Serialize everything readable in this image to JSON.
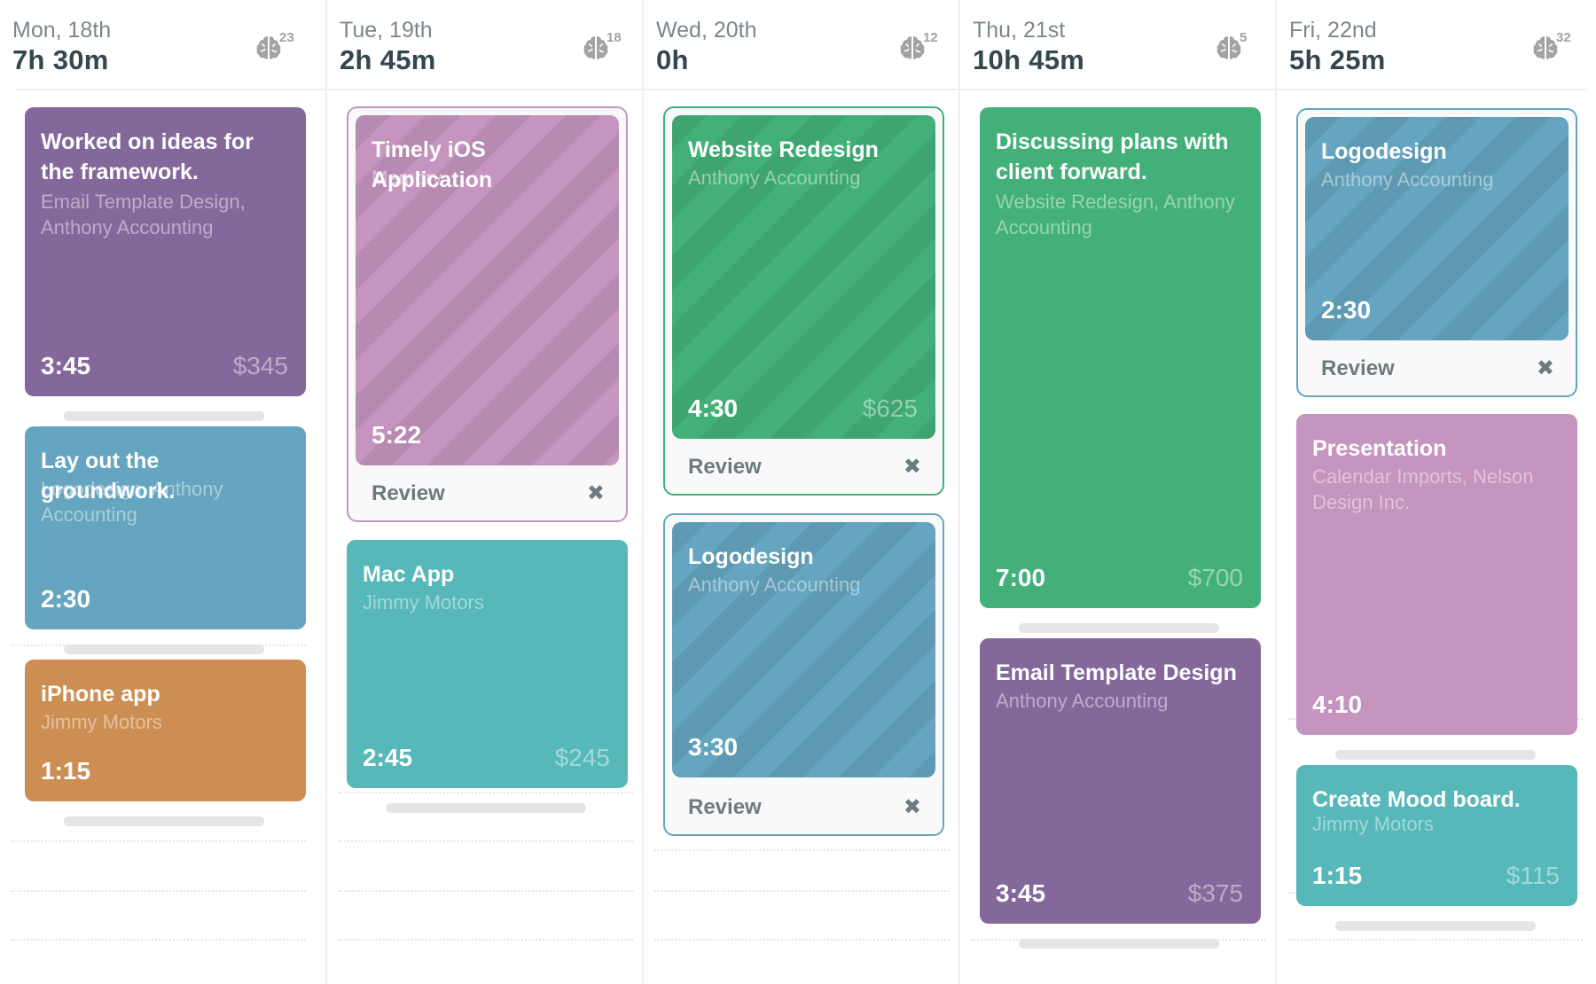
{
  "colors": {
    "purple": "#84689b",
    "blue": "#65a5bf",
    "orange": "#cd8e53",
    "pink": "#c594bf",
    "teal": "#56b8b8",
    "green": "#43b079",
    "header_text": "#34474f",
    "muted_text": "#7d878a"
  },
  "days": [
    {
      "label": "Mon, 18th",
      "total": "7h 30m",
      "brain_count": "23",
      "brain_icon": "brain-icon",
      "entries": [
        {
          "title": "Worked on ideas for the framework.",
          "subtitle": "Email Template Design, Anthony Accounting",
          "duration": "3:45",
          "amount": "$345",
          "color": "purple"
        },
        {
          "title": "Lay out the groundwork.",
          "subtitle": "Logodesign, Anthony Accounting",
          "duration": "2:30",
          "amount": "",
          "color": "blue"
        },
        {
          "title": "iPhone app",
          "subtitle": "Jimmy Motors",
          "duration": "1:15",
          "amount": "",
          "color": "orange"
        }
      ]
    },
    {
      "label": "Tue, 19th",
      "total": "2h 45m",
      "brain_count": "18",
      "brain_icon": "brain-icon",
      "entries": [
        {
          "title": "Timely iOS Application",
          "subtitle": "Memory",
          "duration": "5:22",
          "amount": "",
          "color": "pink",
          "review": true,
          "review_label": "Review",
          "close_icon": "✖"
        },
        {
          "title": "Mac App",
          "subtitle": "Jimmy Motors",
          "duration": "2:45",
          "amount": "$245",
          "color": "teal"
        }
      ]
    },
    {
      "label": "Wed, 20th",
      "total": "0h",
      "brain_count": "12",
      "brain_icon": "brain-icon",
      "entries": [
        {
          "title": "Website Redesign",
          "subtitle": "Anthony Accounting",
          "duration": "4:30",
          "amount": "$625",
          "color": "green",
          "review": true,
          "review_label": "Review",
          "close_icon": "✖"
        },
        {
          "title": "Logodesign",
          "subtitle": "Anthony Accounting",
          "duration": "3:30",
          "amount": "",
          "color": "blue",
          "review": true,
          "review_label": "Review",
          "close_icon": "✖"
        }
      ]
    },
    {
      "label": "Thu, 21st",
      "total": "10h 45m",
      "brain_count": "5",
      "brain_icon": "brain-icon",
      "entries": [
        {
          "title": "Discussing plans with client forward.",
          "subtitle": "Website Redesign, Anthony Accounting",
          "duration": "7:00",
          "amount": "$700",
          "color": "green"
        },
        {
          "title": "Email Template Design",
          "subtitle": "Anthony Accounting",
          "duration": "3:45",
          "amount": "$375",
          "color": "purple"
        }
      ]
    },
    {
      "label": "Fri, 22nd",
      "total": "5h 25m",
      "brain_count": "32",
      "brain_icon": "brain-icon",
      "entries": [
        {
          "title": "Logodesign",
          "subtitle": "Anthony Accounting",
          "duration": "2:30",
          "amount": "",
          "color": "blue",
          "review": true,
          "review_label": "Review",
          "close_icon": "✖"
        },
        {
          "title": "Presentation",
          "subtitle": "Calendar Imports, Nelson Design Inc.",
          "duration": "4:10",
          "amount": "",
          "color": "pink"
        },
        {
          "title": "Create Mood board.",
          "subtitle": "Jimmy Motors",
          "duration": "1:15",
          "amount": "$115",
          "color": "teal"
        }
      ]
    }
  ]
}
